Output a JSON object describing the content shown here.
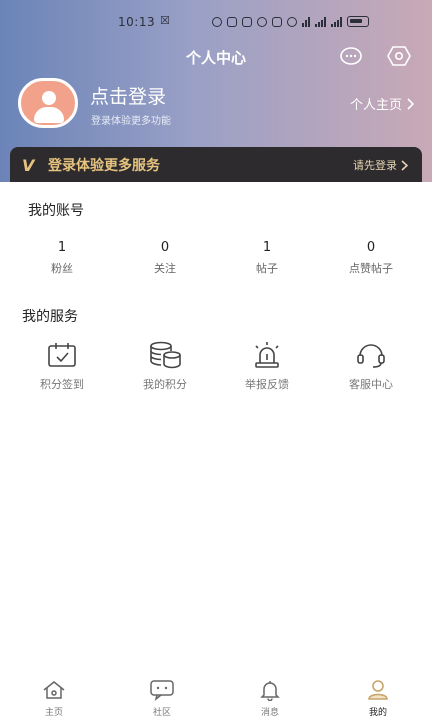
{
  "status": {
    "time": "10:13",
    "mark": "☒"
  },
  "header": {
    "title": "个人中心"
  },
  "profile": {
    "login_title": "点击登录",
    "login_sub": "登录体验更多功能",
    "homepage_link": "个人主页"
  },
  "vip": {
    "logo": "V",
    "text": "登录体验更多服务",
    "button": "请先登录"
  },
  "account": {
    "title": "我的账号",
    "stats": [
      {
        "value": "1",
        "label": "粉丝"
      },
      {
        "value": "0",
        "label": "关注"
      },
      {
        "value": "1",
        "label": "帖子"
      },
      {
        "value": "0",
        "label": "点赞帖子"
      }
    ]
  },
  "services": {
    "title": "我的服务",
    "items": [
      {
        "label": "积分签到",
        "icon": "calendar-check-icon"
      },
      {
        "label": "我的积分",
        "icon": "coins-stack-icon"
      },
      {
        "label": "举报反馈",
        "icon": "alarm-light-icon"
      },
      {
        "label": "客服中心",
        "icon": "headset-icon"
      }
    ]
  },
  "tabbar": {
    "active_color": "#c9a46a",
    "items": [
      {
        "label": "主页",
        "icon": "home-icon"
      },
      {
        "label": "社区",
        "icon": "chat-icon"
      },
      {
        "label": "消息",
        "icon": "bell-icon"
      },
      {
        "label": "我的",
        "icon": "person-icon"
      }
    ]
  }
}
